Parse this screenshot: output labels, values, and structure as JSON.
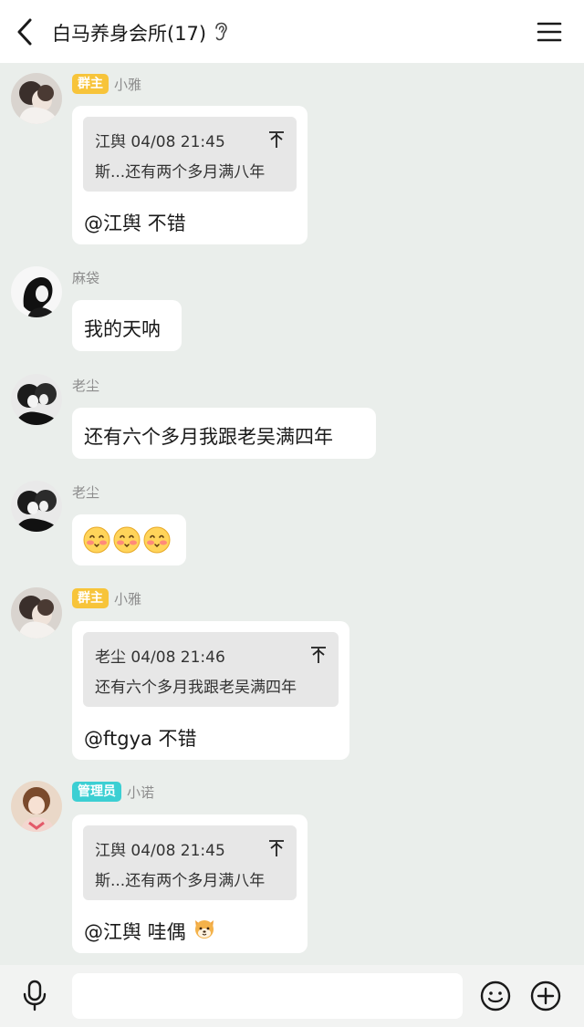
{
  "header": {
    "title": "白马养身会所(17)"
  },
  "messages": [
    {
      "badge": "群主",
      "sender": "小雅",
      "quote": {
        "meta": "江舆 04/08 21:45",
        "text": "斯...还有两个多月满八年"
      },
      "text": "@江舆 不错"
    },
    {
      "sender": "麻袋",
      "text": "我的天呐"
    },
    {
      "sender": "老尘",
      "text": "还有六个多月我跟老吴满四年"
    },
    {
      "sender": "老尘",
      "emoji_count": 3
    },
    {
      "badge": "群主",
      "sender": "小雅",
      "quote": {
        "meta": "老尘 04/08 21:46",
        "text": "还有六个多月我跟老吴满四年"
      },
      "text": "@ftgya 不错"
    },
    {
      "badge": "管理员",
      "sender": "小诺",
      "quote": {
        "meta": "江舆 04/08 21:45",
        "text": "斯...还有两个多月满八年"
      },
      "text": "@江舆 哇偶"
    }
  ],
  "colors": {
    "background": "#eaeeeb",
    "owner_badge": "#f7c43a",
    "admin_badge": "#3ccfd3",
    "bubble": "#ffffff",
    "quote_bg": "#e7e7e7"
  },
  "icons": [
    "back-arrow-icon",
    "ear-icon",
    "menu-icon",
    "quote-jump-icon",
    "blush-emoji-icon",
    "shiba-emoji-icon",
    "microphone-icon",
    "smiley-icon",
    "plus-circle-icon"
  ]
}
